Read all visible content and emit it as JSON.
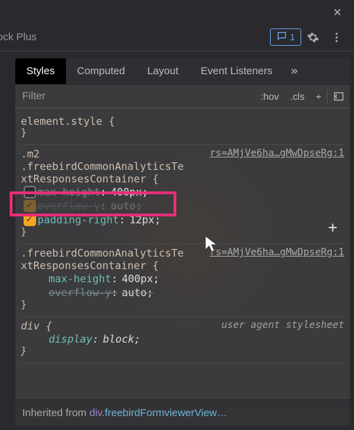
{
  "topbar": {
    "close_label": "×"
  },
  "extbar": {
    "extension_name": "ock Plus",
    "messages_count": "1"
  },
  "tabs": {
    "items": [
      {
        "label": "Styles",
        "active": true
      },
      {
        "label": "Computed",
        "active": false
      },
      {
        "label": "Layout",
        "active": false
      },
      {
        "label": "Event Listeners",
        "active": false
      }
    ],
    "more": "»"
  },
  "filter": {
    "placeholder": "Filter",
    "hov": ":hov",
    "cls": ".cls",
    "add": "+"
  },
  "rules": {
    "r0": {
      "selector": "element.style",
      "brace_open": "{",
      "brace_close": "}"
    },
    "r1": {
      "selector_line1": ".m2",
      "selector_line2": ".freebirdCommonAnalyticsTextResponsesContainer",
      "source": "rs=AMjVe6ha…gMwDpseRg:1",
      "brace_open": "{",
      "brace_close": "}",
      "decls": [
        {
          "checked": false,
          "prop": "max-height",
          "val": "400px",
          "struck": true
        },
        {
          "checked": true,
          "prop": "overflow-y",
          "val": "auto",
          "struck": true,
          "hidden": true
        },
        {
          "checked": true,
          "prop": "padding-right",
          "val": "12px",
          "struck": false
        }
      ],
      "add": "+"
    },
    "r2": {
      "selector": ".freebirdCommonAnalyticsTextResponsesContainer",
      "source": "rs=AMjVe6ha…gMwDpseRg:1",
      "brace_open": "{",
      "brace_close": "}",
      "decls": [
        {
          "prop": "max-height",
          "val": "400px",
          "struck": false
        },
        {
          "prop": "overflow-y",
          "val": "auto",
          "struck": true
        }
      ]
    },
    "r3": {
      "selector": "div",
      "uas": "user agent stylesheet",
      "brace_open": "{",
      "brace_close": "}",
      "decls": [
        {
          "prop": "display",
          "val": "block",
          "struck": false
        }
      ]
    }
  },
  "inherited": {
    "prefix": "Inherited from ",
    "tag": "div",
    "cls": ".freebirdFormviewerView…"
  }
}
